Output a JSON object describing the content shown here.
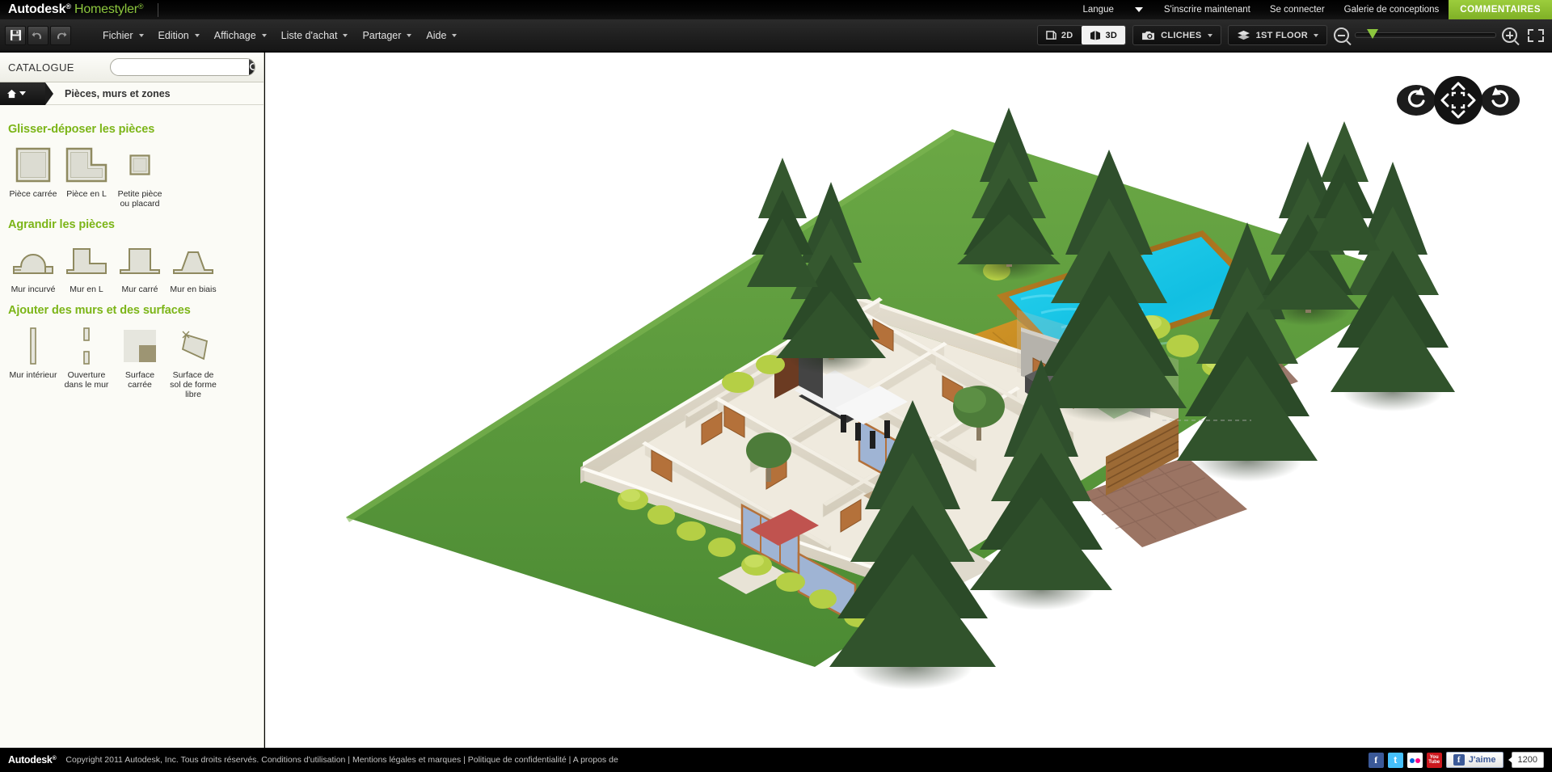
{
  "top_bar": {
    "brand_primary": "Autodesk",
    "brand_secondary": "Homestyler",
    "language_label": "Langue",
    "links": [
      {
        "label": "S'inscrire maintenant",
        "name": "signup-link"
      },
      {
        "label": "Se connecter",
        "name": "login-link"
      },
      {
        "label": "Galerie de conceptions",
        "name": "gallery-link"
      }
    ],
    "comments_button": "COMMENTAIRES",
    "accent_green": "#8cc63e"
  },
  "toolbar": {
    "icons": [
      {
        "name": "save-icon",
        "title": "Enregistrer"
      },
      {
        "name": "undo-icon",
        "title": "Annuler"
      },
      {
        "name": "redo-icon",
        "title": "Rétablir"
      }
    ],
    "menus": [
      {
        "label": "Fichier",
        "name": "menu-fichier"
      },
      {
        "label": "Edition",
        "name": "menu-edition"
      },
      {
        "label": "Affichage",
        "name": "menu-affichage"
      },
      {
        "label": "Liste d'achat",
        "name": "menu-liste-achat"
      },
      {
        "label": "Partager",
        "name": "menu-partager"
      },
      {
        "label": "Aide",
        "name": "menu-aide"
      }
    ],
    "view_2d": "2D",
    "view_3d": "3D",
    "view_active": "3D",
    "snapshots_label": "CLICHES",
    "floor_label": "1ST FLOOR",
    "zoom_percent": 6
  },
  "catalogue": {
    "title": "CATALOGUE",
    "search_placeholder": "",
    "search_value": "",
    "breadcrumb": "Pièces, murs et zones",
    "sections": [
      {
        "title": "Glisser-déposer les pièces",
        "name": "section-drag-drop-rooms",
        "items": [
          {
            "label": "Pièce carrée",
            "icon": "square-room-icon"
          },
          {
            "label": "Pièce en L",
            "icon": "l-room-icon"
          },
          {
            "label": "Petite pièce ou placard",
            "icon": "small-room-icon"
          }
        ]
      },
      {
        "title": "Agrandir les pièces",
        "name": "section-enlarge-rooms",
        "items": [
          {
            "label": "Mur incurvé",
            "icon": "curved-wall-icon"
          },
          {
            "label": "Mur en L",
            "icon": "l-wall-icon"
          },
          {
            "label": "Mur carré",
            "icon": "square-wall-icon"
          },
          {
            "label": "Mur en biais",
            "icon": "angled-wall-icon"
          }
        ]
      },
      {
        "title": "Ajouter des murs et des surfaces",
        "name": "section-add-walls-surfaces",
        "items": [
          {
            "label": "Mur intérieur",
            "icon": "interior-wall-icon"
          },
          {
            "label": "Ouverture dans le mur",
            "icon": "wall-opening-icon"
          },
          {
            "label": "Surface carrée",
            "icon": "square-surface-icon"
          },
          {
            "label": "Surface de sol de forme libre",
            "icon": "freeform-floor-icon"
          }
        ]
      }
    ],
    "section_title_color": "#7cb518"
  },
  "scene": {
    "description": "Vue 3D isométrique d'une maison de plain-pied avec piscine, terrasse en bois, pelouse et pins",
    "colors": {
      "grass": "#5d9e3f",
      "pool_water": "#18c8e8",
      "pool_deck": "#a7711e",
      "wall": "#f3efe6",
      "roof_terrace": "#c98a24",
      "driveway": "#8d6b59",
      "tree_dark": "#2d4a2a",
      "background": "#ffffff"
    }
  },
  "compass": {
    "rotate_left": "rotate-left-icon",
    "rotate_right": "rotate-right-icon",
    "pan_up": "pan-up-icon",
    "pan_down": "pan-down-icon",
    "pan_left": "pan-left-icon",
    "pan_right": "pan-right-icon",
    "center": "recenter-icon"
  },
  "footer": {
    "logo": "Autodesk",
    "copyright": "Copyright 2011 Autodesk, Inc. Tous droits réservés. Conditions d'utilisation | Mentions légales et marques | Politique de confidentialité | A propos de",
    "social": [
      {
        "name": "facebook-icon",
        "label": "f"
      },
      {
        "name": "twitter-icon",
        "label": "t"
      },
      {
        "name": "flickr-icon",
        "label": ""
      },
      {
        "name": "youtube-icon",
        "label": "You"
      }
    ],
    "like_label": "J'aime",
    "like_count": "1200"
  }
}
